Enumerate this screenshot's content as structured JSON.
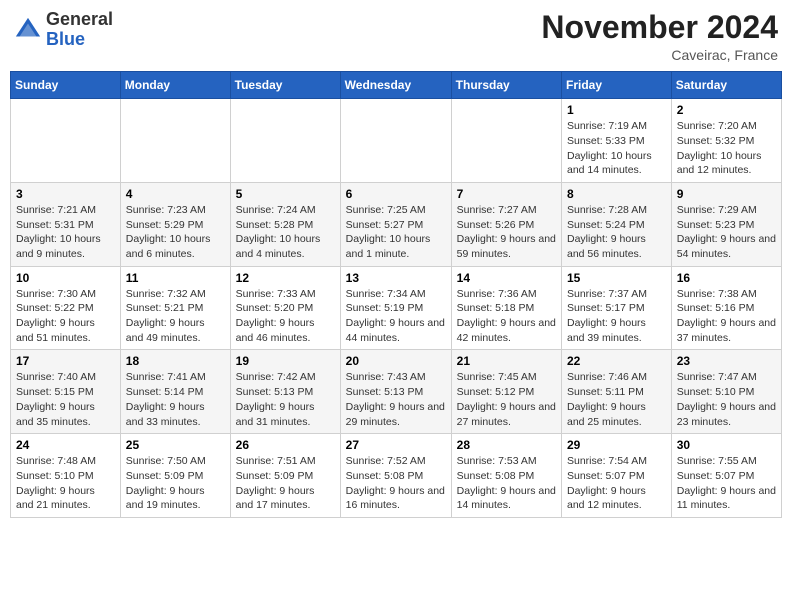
{
  "header": {
    "logo_line1": "General",
    "logo_line2": "Blue",
    "month_title": "November 2024",
    "location": "Caveirac, France"
  },
  "days_of_week": [
    "Sunday",
    "Monday",
    "Tuesday",
    "Wednesday",
    "Thursday",
    "Friday",
    "Saturday"
  ],
  "weeks": [
    [
      {
        "day": "",
        "info": ""
      },
      {
        "day": "",
        "info": ""
      },
      {
        "day": "",
        "info": ""
      },
      {
        "day": "",
        "info": ""
      },
      {
        "day": "",
        "info": ""
      },
      {
        "day": "1",
        "info": "Sunrise: 7:19 AM\nSunset: 5:33 PM\nDaylight: 10 hours and 14 minutes."
      },
      {
        "day": "2",
        "info": "Sunrise: 7:20 AM\nSunset: 5:32 PM\nDaylight: 10 hours and 12 minutes."
      }
    ],
    [
      {
        "day": "3",
        "info": "Sunrise: 7:21 AM\nSunset: 5:31 PM\nDaylight: 10 hours and 9 minutes."
      },
      {
        "day": "4",
        "info": "Sunrise: 7:23 AM\nSunset: 5:29 PM\nDaylight: 10 hours and 6 minutes."
      },
      {
        "day": "5",
        "info": "Sunrise: 7:24 AM\nSunset: 5:28 PM\nDaylight: 10 hours and 4 minutes."
      },
      {
        "day": "6",
        "info": "Sunrise: 7:25 AM\nSunset: 5:27 PM\nDaylight: 10 hours and 1 minute."
      },
      {
        "day": "7",
        "info": "Sunrise: 7:27 AM\nSunset: 5:26 PM\nDaylight: 9 hours and 59 minutes."
      },
      {
        "day": "8",
        "info": "Sunrise: 7:28 AM\nSunset: 5:24 PM\nDaylight: 9 hours and 56 minutes."
      },
      {
        "day": "9",
        "info": "Sunrise: 7:29 AM\nSunset: 5:23 PM\nDaylight: 9 hours and 54 minutes."
      }
    ],
    [
      {
        "day": "10",
        "info": "Sunrise: 7:30 AM\nSunset: 5:22 PM\nDaylight: 9 hours and 51 minutes."
      },
      {
        "day": "11",
        "info": "Sunrise: 7:32 AM\nSunset: 5:21 PM\nDaylight: 9 hours and 49 minutes."
      },
      {
        "day": "12",
        "info": "Sunrise: 7:33 AM\nSunset: 5:20 PM\nDaylight: 9 hours and 46 minutes."
      },
      {
        "day": "13",
        "info": "Sunrise: 7:34 AM\nSunset: 5:19 PM\nDaylight: 9 hours and 44 minutes."
      },
      {
        "day": "14",
        "info": "Sunrise: 7:36 AM\nSunset: 5:18 PM\nDaylight: 9 hours and 42 minutes."
      },
      {
        "day": "15",
        "info": "Sunrise: 7:37 AM\nSunset: 5:17 PM\nDaylight: 9 hours and 39 minutes."
      },
      {
        "day": "16",
        "info": "Sunrise: 7:38 AM\nSunset: 5:16 PM\nDaylight: 9 hours and 37 minutes."
      }
    ],
    [
      {
        "day": "17",
        "info": "Sunrise: 7:40 AM\nSunset: 5:15 PM\nDaylight: 9 hours and 35 minutes."
      },
      {
        "day": "18",
        "info": "Sunrise: 7:41 AM\nSunset: 5:14 PM\nDaylight: 9 hours and 33 minutes."
      },
      {
        "day": "19",
        "info": "Sunrise: 7:42 AM\nSunset: 5:13 PM\nDaylight: 9 hours and 31 minutes."
      },
      {
        "day": "20",
        "info": "Sunrise: 7:43 AM\nSunset: 5:13 PM\nDaylight: 9 hours and 29 minutes."
      },
      {
        "day": "21",
        "info": "Sunrise: 7:45 AM\nSunset: 5:12 PM\nDaylight: 9 hours and 27 minutes."
      },
      {
        "day": "22",
        "info": "Sunrise: 7:46 AM\nSunset: 5:11 PM\nDaylight: 9 hours and 25 minutes."
      },
      {
        "day": "23",
        "info": "Sunrise: 7:47 AM\nSunset: 5:10 PM\nDaylight: 9 hours and 23 minutes."
      }
    ],
    [
      {
        "day": "24",
        "info": "Sunrise: 7:48 AM\nSunset: 5:10 PM\nDaylight: 9 hours and 21 minutes."
      },
      {
        "day": "25",
        "info": "Sunrise: 7:50 AM\nSunset: 5:09 PM\nDaylight: 9 hours and 19 minutes."
      },
      {
        "day": "26",
        "info": "Sunrise: 7:51 AM\nSunset: 5:09 PM\nDaylight: 9 hours and 17 minutes."
      },
      {
        "day": "27",
        "info": "Sunrise: 7:52 AM\nSunset: 5:08 PM\nDaylight: 9 hours and 16 minutes."
      },
      {
        "day": "28",
        "info": "Sunrise: 7:53 AM\nSunset: 5:08 PM\nDaylight: 9 hours and 14 minutes."
      },
      {
        "day": "29",
        "info": "Sunrise: 7:54 AM\nSunset: 5:07 PM\nDaylight: 9 hours and 12 minutes."
      },
      {
        "day": "30",
        "info": "Sunrise: 7:55 AM\nSunset: 5:07 PM\nDaylight: 9 hours and 11 minutes."
      }
    ]
  ]
}
